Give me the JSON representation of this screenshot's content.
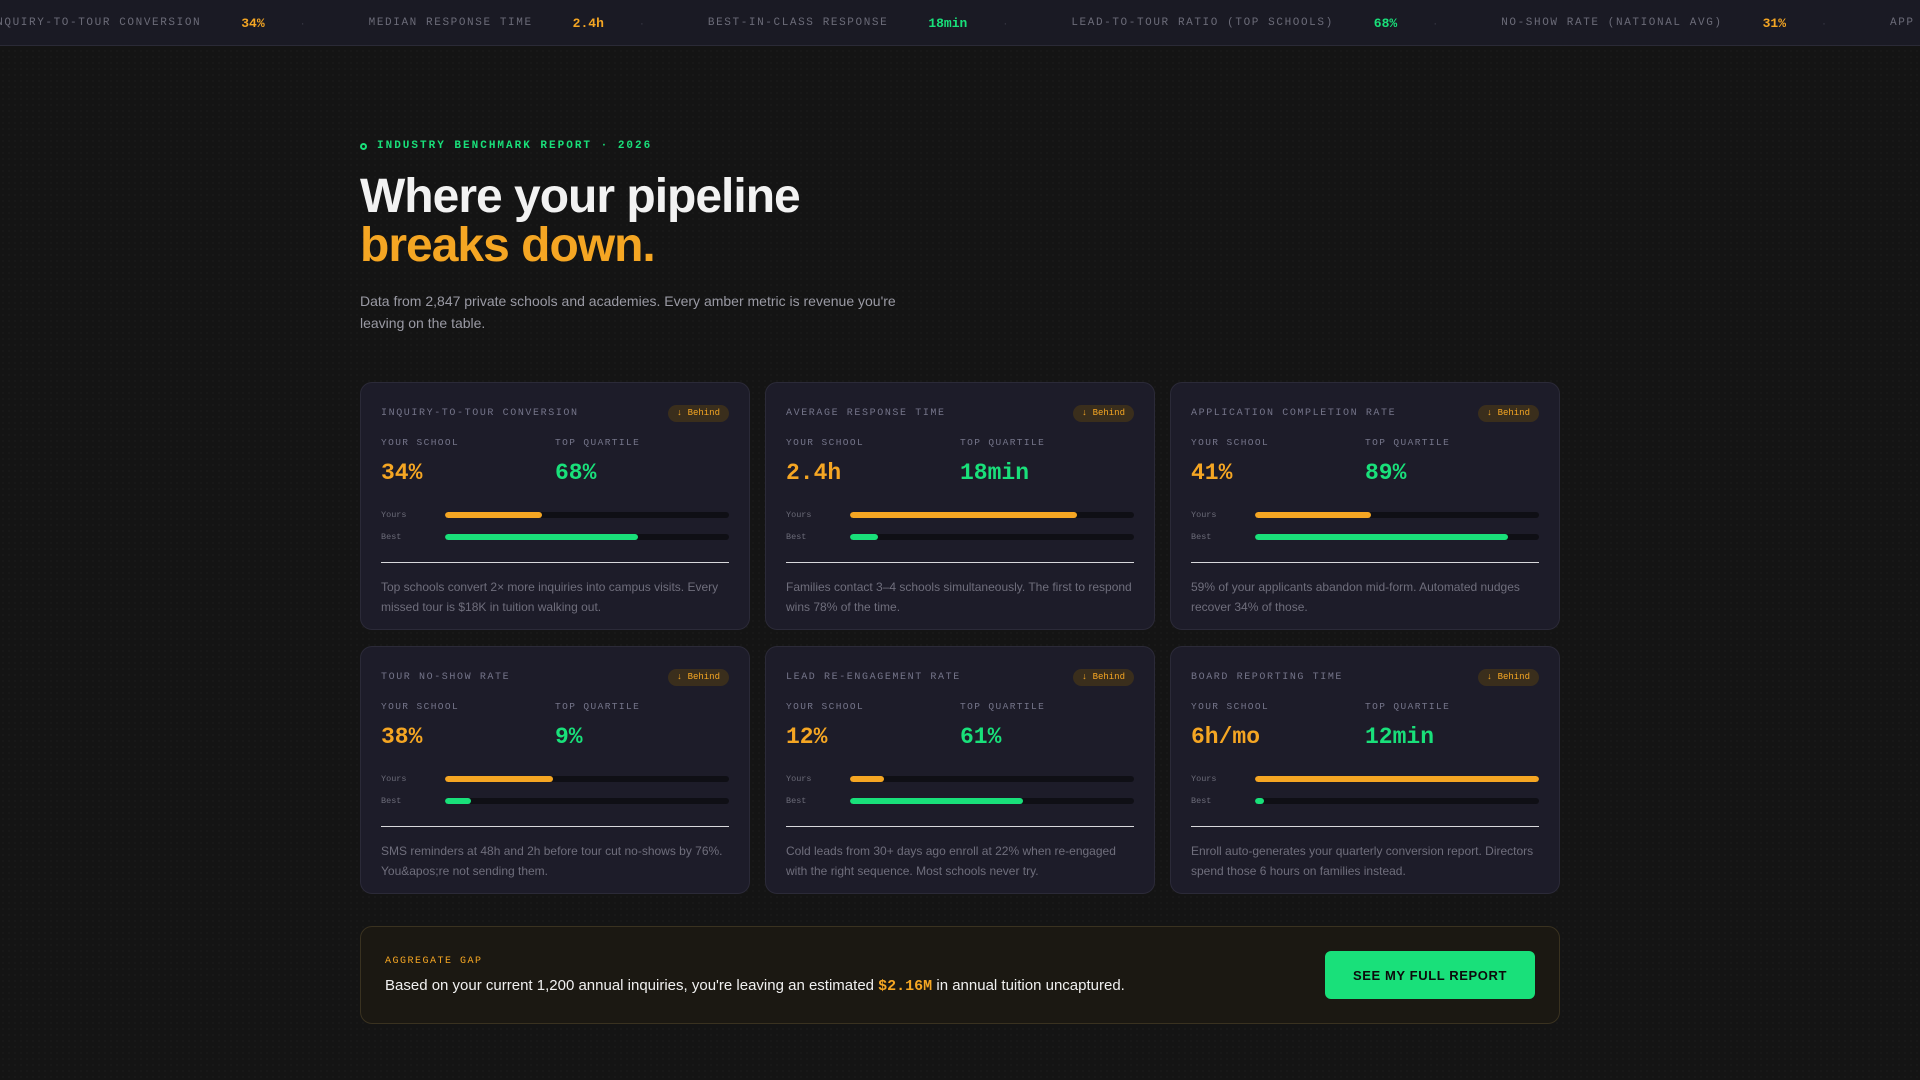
{
  "ticker": [
    {
      "label": "INQUIRY-TO-TOUR CONVERSION",
      "value": "34%",
      "tone": "amber"
    },
    {
      "label": "MEDIAN RESPONSE TIME",
      "value": "2.4h",
      "tone": "amber"
    },
    {
      "label": "BEST-IN-CLASS RESPONSE",
      "value": "18min",
      "tone": "green"
    },
    {
      "label": "LEAD-TO-TOUR RATIO (TOP SCHOOLS)",
      "value": "68%",
      "tone": "green"
    },
    {
      "label": "NO-SHOW RATE (NATIONAL AVG)",
      "value": "31%",
      "tone": "amber"
    },
    {
      "label": "APP COMPLETION RATE (E",
      "value": "",
      "tone": "amber"
    }
  ],
  "ticker_separator": "·",
  "hero": {
    "eyebrow": "INDUSTRY BENCHMARK REPORT · 2026",
    "title_line1": "Where your pipeline",
    "title_line2": "breaks down.",
    "subtitle": "Data from 2,847 private schools and academies. Every amber metric is revenue you're leaving on the table."
  },
  "labels": {
    "your_school": "YOUR SCHOOL",
    "top_quartile": "TOP QUARTILE",
    "yours": "Yours",
    "best": "Best"
  },
  "cards": [
    {
      "title": "INQUIRY-TO-TOUR CONVERSION",
      "badge": "↓ Behind",
      "yours": "34%",
      "top": "68%",
      "yours_level": 0.34,
      "best_level": 0.68,
      "desc": "Top schools convert 2× more inquiries into campus visits. Every missed tour is $18K in tuition walking out."
    },
    {
      "title": "AVERAGE RESPONSE TIME",
      "badge": "↓ Behind",
      "yours": "2.4h",
      "top": "18min",
      "yours_level": 0.8,
      "best_level": 0.1,
      "desc": "Families contact 3–4 schools simultaneously. The first to respond wins 78% of the time."
    },
    {
      "title": "APPLICATION COMPLETION RATE",
      "badge": "↓ Behind",
      "yours": "41%",
      "top": "89%",
      "yours_level": 0.41,
      "best_level": 0.89,
      "desc": "59% of your applicants abandon mid-form. Automated nudges recover 34% of those."
    },
    {
      "title": "TOUR NO-SHOW RATE",
      "badge": "↓ Behind",
      "yours": "38%",
      "top": "9%",
      "yours_level": 0.38,
      "best_level": 0.09,
      "desc": "SMS reminders at 48h and 2h before tour cut no-shows by 76%. You&apos;re not sending them."
    },
    {
      "title": "LEAD RE-ENGAGEMENT RATE",
      "badge": "↓ Behind",
      "yours": "12%",
      "top": "61%",
      "yours_level": 0.12,
      "best_level": 0.61,
      "desc": "Cold leads from 30+ days ago enroll at 22% when re-engaged with the right sequence. Most schools never try."
    },
    {
      "title": "BOARD REPORTING TIME",
      "badge": "↓ Behind",
      "yours": "6h/mo",
      "top": "12min",
      "yours_level": 1.0,
      "best_level": 0.03,
      "desc": "Enroll auto-generates your quarterly conversion report. Directors spend those 6 hours on families instead."
    }
  ],
  "aggregate": {
    "label": "AGGREGATE GAP",
    "text_before": "Based on your current 1,200 annual inquiries, you're leaving an estimated ",
    "amount": "$2.16M",
    "text_after": " in annual tuition uncaptured.",
    "cta": "SEE MY FULL REPORT"
  },
  "colors": {
    "amber": "#f5a623",
    "green": "#19e07a",
    "background": "#141414",
    "card": "#1d1c29"
  }
}
